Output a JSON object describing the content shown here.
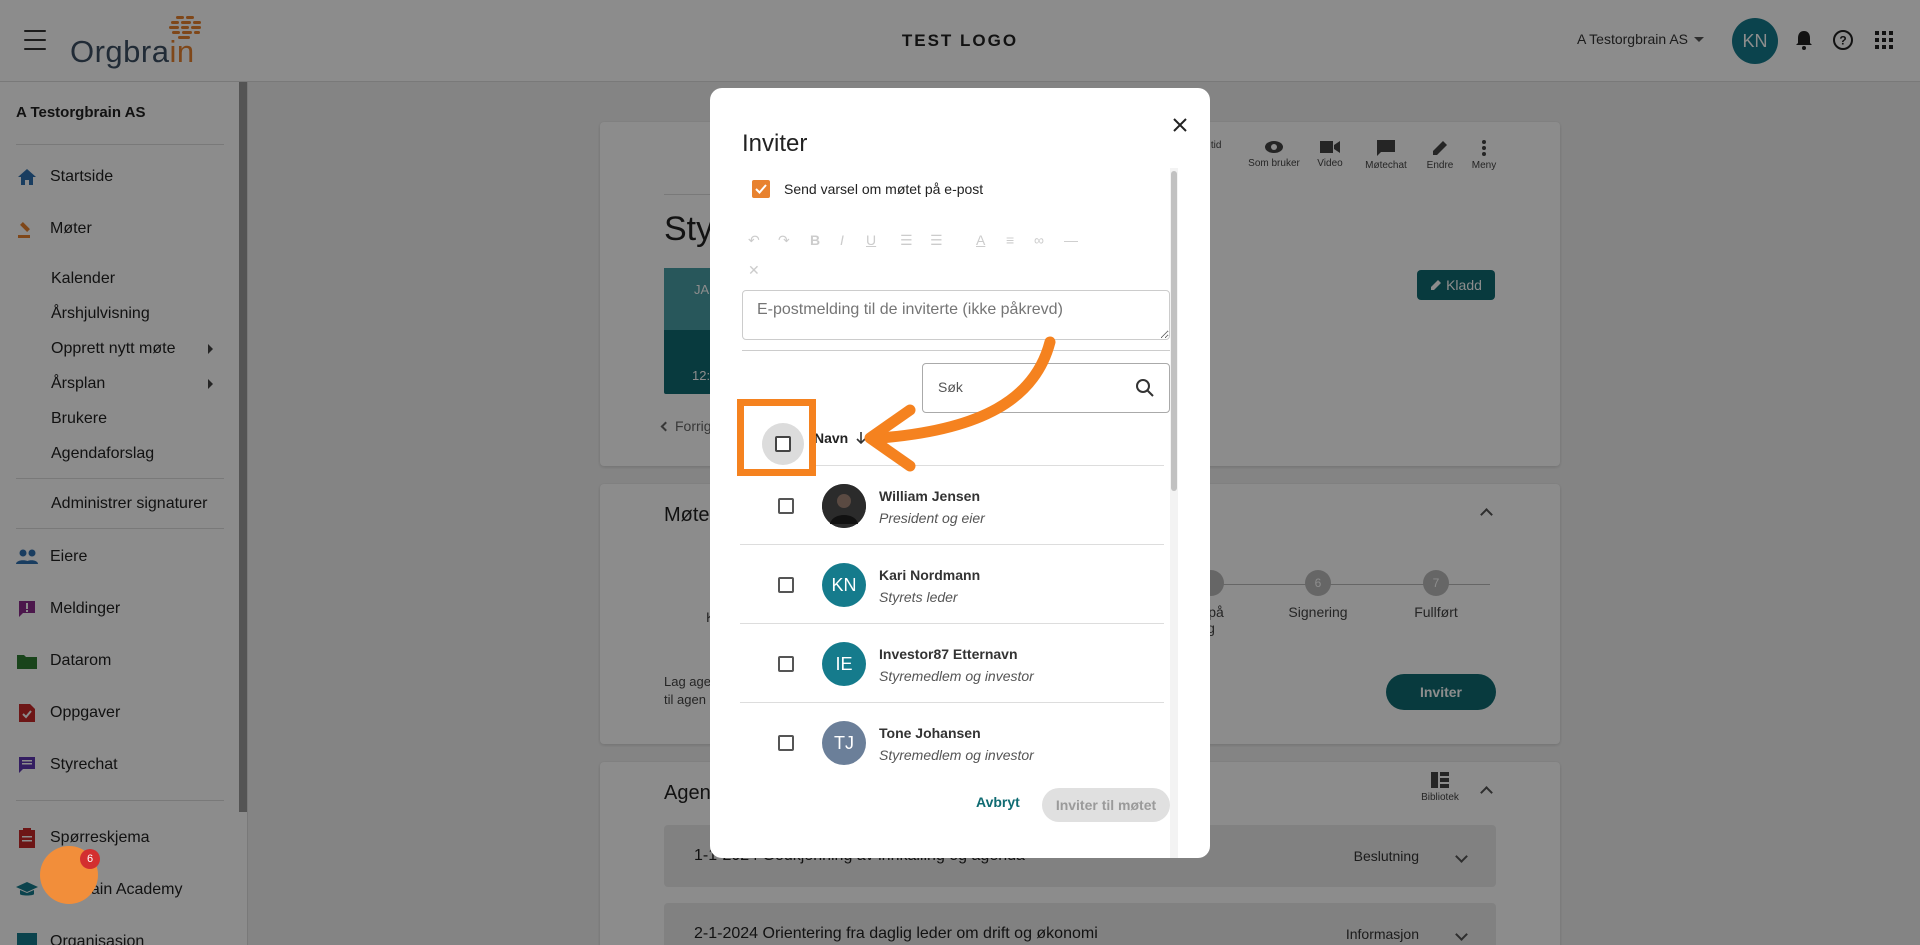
{
  "topbar": {
    "logo_text_main": "Orgbrain",
    "center_logo": "TEST LOGO",
    "org_name": "A Testorgbrain AS",
    "avatar_initials": "KN"
  },
  "sidebar": {
    "org_name": "A Testorgbrain AS",
    "items": {
      "startside": "Startside",
      "moter": "Møter",
      "kalender": "Kalender",
      "arshjul": "Årshjulvisning",
      "opprett": "Opprett nytt møte",
      "arsplan": "Årsplan",
      "brukere": "Brukere",
      "agendaforslag": "Agendaforslag",
      "signaturer": "Administrer signaturer",
      "eiere": "Eiere",
      "meldinger": "Meldinger",
      "datarom": "Datarom",
      "oppgaver": "Oppgaver",
      "styrechat": "Styrechat",
      "sporreskjema": "Spørreskjema",
      "academy": "Orgbrain Academy",
      "organisasjon": "Organisasjon"
    },
    "chat_badge": "6"
  },
  "meeting": {
    "title_fragment": "Sty",
    "date_fragment_top": "JA",
    "time_fragment": "12:",
    "prev_link": "Forrig",
    "toolbar": [
      {
        "label": "n tid",
        "icon": "calendar-icon"
      },
      {
        "label": "Som bruker",
        "icon": "eye-icon"
      },
      {
        "label": "Video",
        "icon": "video-icon"
      },
      {
        "label": "Møtechat",
        "icon": "chat-icon"
      },
      {
        "label": "Endre",
        "icon": "pencil-icon"
      },
      {
        "label": "Meny",
        "icon": "more-icon"
      }
    ],
    "status_badge": "Kladd",
    "section_title": "Møte",
    "steps": [
      {
        "num": "",
        "label": "ll på",
        "label2": "g"
      },
      {
        "num": "6",
        "label": "Signering",
        "label2": ""
      },
      {
        "num": "7",
        "label": "Fullført",
        "label2": ""
      }
    ],
    "step_left_fragment": "K",
    "info_line1": "Lag age",
    "info_line2": "til agen",
    "invite_button": "Inviter",
    "agenda_title": "Agen",
    "library_label": "Bibliotek",
    "agenda_items": [
      {
        "title": "1-1-2024 Godkjenning av innkalling og agenda",
        "type": "Beslutning"
      },
      {
        "title": "2-1-2024 Orientering fra daglig leder om drift og økonomi",
        "type": "Informasjon"
      }
    ]
  },
  "modal": {
    "title": "Inviter",
    "notify_label": "Send varsel om møtet på e-post",
    "email_placeholder": "E-postmelding til de inviterte (ikke påkrevd)",
    "search_placeholder": "Søk",
    "name_header": "Navn",
    "people": [
      {
        "name": "William Jensen",
        "role": "President og eier",
        "initials": "",
        "color": "#2b2b2b"
      },
      {
        "name": "Kari Nordmann",
        "role": "Styrets leder",
        "initials": "KN",
        "color": "#157b8c"
      },
      {
        "name": "Investor87 Etternavn",
        "role": "Styremedlem og investor",
        "initials": "IE",
        "color": "#157b8c"
      },
      {
        "name": "Tone Johansen",
        "role": "Styremedlem og investor",
        "initials": "TJ",
        "color": "#6b7f99"
      }
    ],
    "cancel": "Avbryt",
    "submit": "Inviter til møtet"
  },
  "colors": {
    "brand_teal": "#0f6b72",
    "highlight_orange": "#f5821f",
    "checkbox_orange": "#e8822f"
  }
}
